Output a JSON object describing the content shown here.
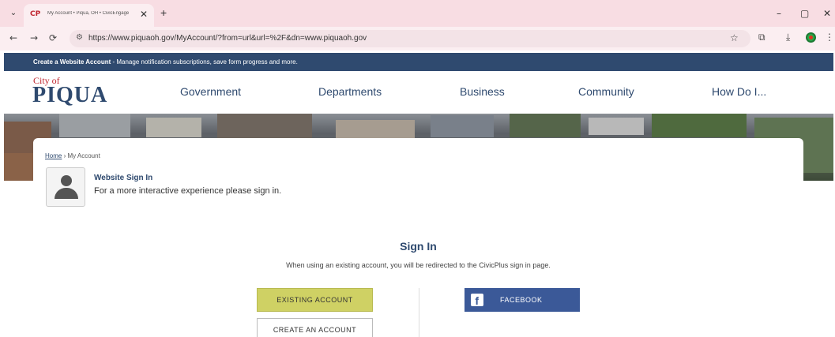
{
  "browser": {
    "tab_dropdown_icon": "chevron-down-icon",
    "tab_title": "My Account • Piqua, OH • CivicEngage",
    "tab_favicon": "CP",
    "tab_close": "✕",
    "new_tab": "+",
    "url": "https://www.piquaoh.gov/MyAccount/?from=url&url=%2F&dn=www.piquaoh.gov",
    "back": "←",
    "forward": "→",
    "reload": "⟳",
    "site_info": "⚙",
    "star": "☆",
    "extensions": "⧉",
    "download": "⤓",
    "menu": "⋮",
    "minimize": "–",
    "maximize": "▢",
    "close": "✕"
  },
  "notice": {
    "bold": "Create a Website Account",
    "text": " - Manage notification subscriptions, save form progress and more."
  },
  "header": {
    "logo_city": "City of",
    "logo_name": "PIQUA",
    "nav": [
      "Government",
      "Departments",
      "Business",
      "Community",
      "How Do I..."
    ]
  },
  "breadcrumb": {
    "home": "Home",
    "sep": " › ",
    "current": "My Account"
  },
  "website_signin": {
    "title": "Website Sign In",
    "subtitle": "For a more interactive experience please sign in."
  },
  "signin": {
    "heading": "Sign In",
    "description": "When using an existing account, you will be redirected to the CivicPlus sign in page.",
    "existing_button": "EXISTING ACCOUNT",
    "create_button": "CREATE AN ACCOUNT",
    "facebook_button": "FACEBOOK",
    "facebook_icon": "f"
  },
  "colors": {
    "brand_navy": "#2f4a6f",
    "brand_red": "#c0262f",
    "existing_btn": "#cfd164",
    "facebook": "#3b5998"
  }
}
